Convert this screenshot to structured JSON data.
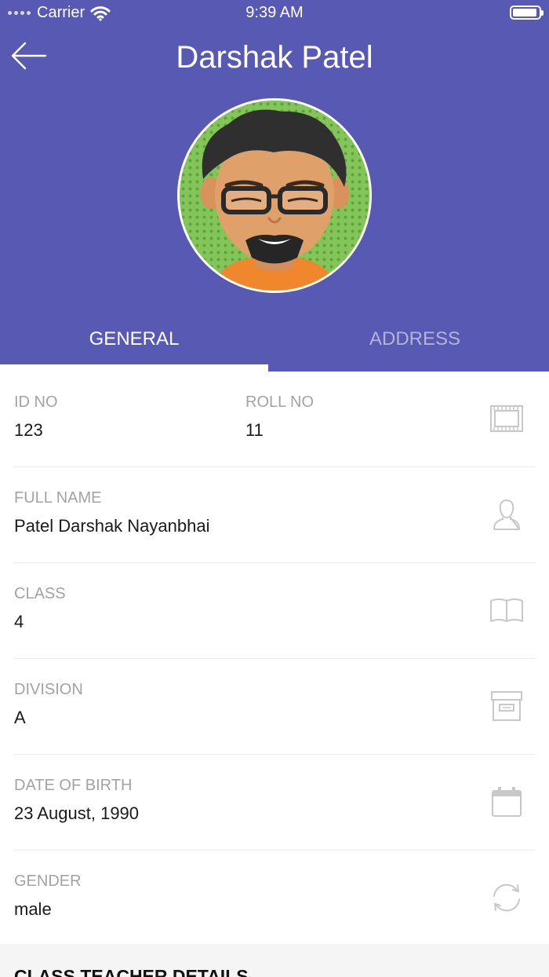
{
  "status_bar": {
    "carrier": "Carrier",
    "time": "9:39 AM"
  },
  "header": {
    "title": "Darshak Patel"
  },
  "tabs": [
    {
      "label": "GENERAL",
      "active": true
    },
    {
      "label": "ADDRESS",
      "active": false
    }
  ],
  "fields": {
    "id_no": {
      "label": "ID NO",
      "value": "123"
    },
    "roll_no": {
      "label": "ROLL NO",
      "value": "11"
    },
    "full_name": {
      "label": "FULL NAME",
      "value": "Patel Darshak Nayanbhai"
    },
    "class": {
      "label": "CLASS",
      "value": "4"
    },
    "division": {
      "label": "DIVISION",
      "value": "A"
    },
    "date_of_birth": {
      "label": "DATE OF BIRTH",
      "value": "23 August, 1990"
    },
    "gender": {
      "label": "GENDER",
      "value": "male"
    }
  },
  "section": {
    "title": "CLASS TEACHER DETAILS"
  },
  "icons": {
    "id": "film-strip-icon",
    "name": "person-icon",
    "class": "book-icon",
    "division": "archive-box-icon",
    "dob": "calendar-icon",
    "gender": "refresh-icon"
  },
  "colors": {
    "header_bg": "#5859b3",
    "label": "#a3a3a3",
    "inactive_tab": "#b3b3d6"
  }
}
